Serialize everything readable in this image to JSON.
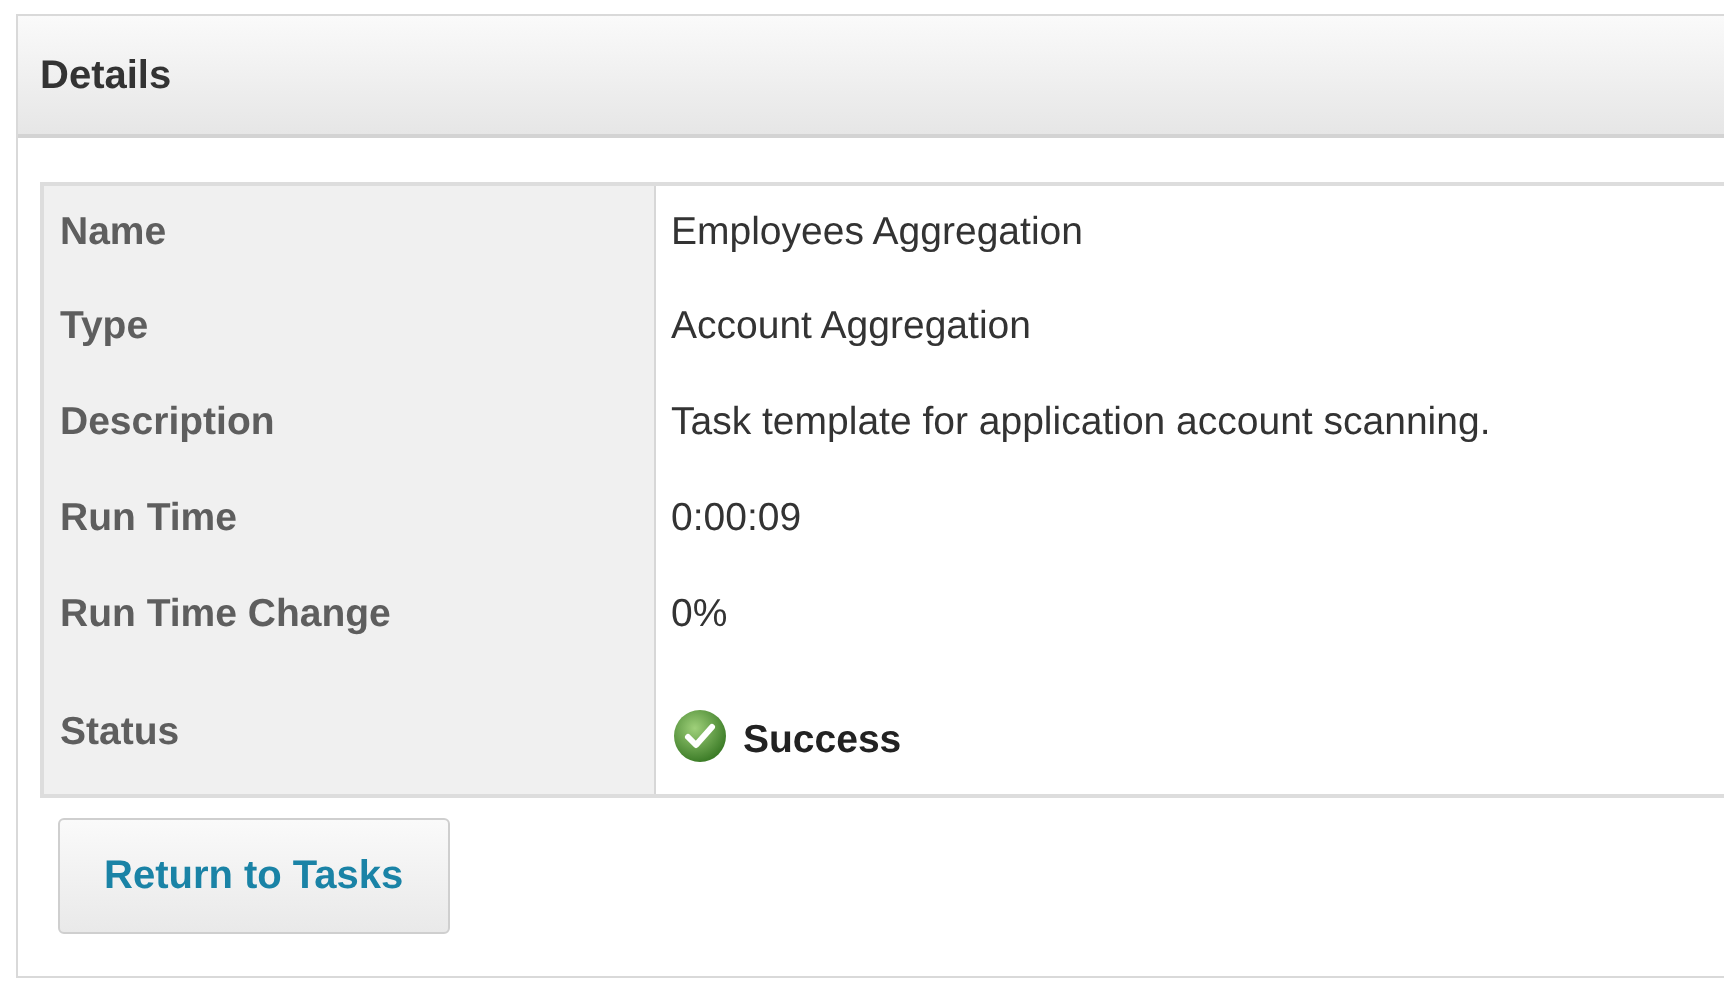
{
  "panel": {
    "title": "Details"
  },
  "details": [
    {
      "kind": "text",
      "label": "Name",
      "value": "Employees Aggregation"
    },
    {
      "kind": "text",
      "label": "Type",
      "value": "Account Aggregation"
    },
    {
      "kind": "text",
      "label": "Description",
      "value": "Task template for application account scanning."
    },
    {
      "kind": "text",
      "label": "Run Time",
      "value": "0:00:09"
    },
    {
      "kind": "text",
      "label": "Run Time Change",
      "value": "0%"
    },
    {
      "kind": "status",
      "label": "Status",
      "value": "Success",
      "succeeded": true
    }
  ],
  "buttons": [
    "Return to Tasks"
  ]
}
